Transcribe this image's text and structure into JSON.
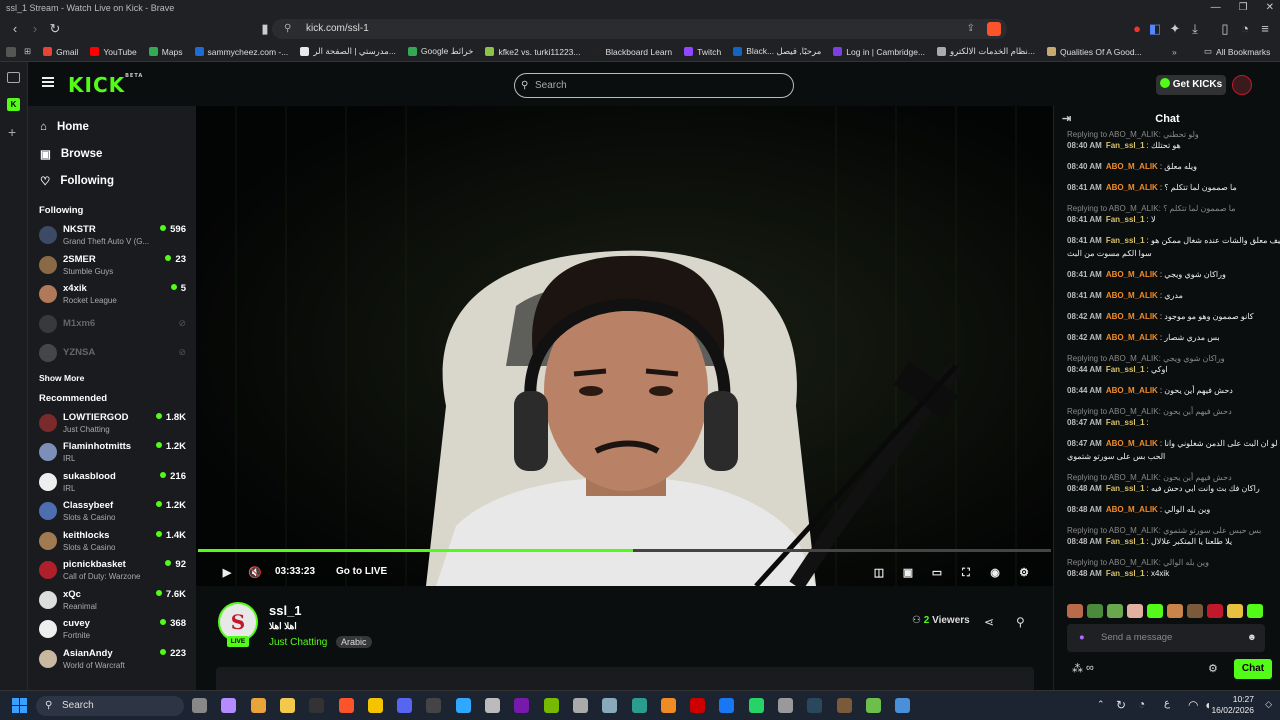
{
  "browser": {
    "window_title": "ssl_1 Stream - Watch Live on Kick - Brave",
    "url": "kick.com/ssl-1",
    "bookmarks": [
      {
        "label": "Gmail",
        "color": "#ea4335"
      },
      {
        "label": "YouTube",
        "color": "#ff0000"
      },
      {
        "label": "Maps",
        "color": "#34a853"
      },
      {
        "label": "sammycheez.com -...",
        "color": "#1e6bd6"
      },
      {
        "label": "مدرستي | الصفحة الر...",
        "color": "#e8e8e8"
      },
      {
        "label": "Google خرائط",
        "color": "#34a853"
      },
      {
        "label": "kfke2 vs. turki11223...",
        "color": "#8bc34a"
      },
      {
        "label": "Blackboard Learn",
        "color": "#222222"
      },
      {
        "label": "Twitch",
        "color": "#9146ff"
      },
      {
        "label": "Black... مرحبًا, فيصل",
        "color": "#1565c0"
      },
      {
        "label": "Log in | Cambridge...",
        "color": "#7b3fe4"
      },
      {
        "label": "نظام الخدمات الالكترو...",
        "color": "#aaaaaa"
      },
      {
        "label": "Qualities Of A Good...",
        "color": "#c8a96e"
      }
    ],
    "all_bookmarks": "All Bookmarks"
  },
  "kick": {
    "logo": "KICK",
    "logo_beta": "BETA",
    "search_placeholder": "Search",
    "get_kicks": "Get KICKs",
    "nav": [
      {
        "label": "Home",
        "icon": "home-icon"
      },
      {
        "label": "Browse",
        "icon": "browse-icon"
      },
      {
        "label": "Following",
        "icon": "heart-icon"
      }
    ],
    "following_title": "Following",
    "following": [
      {
        "name": "NKSTR",
        "category": "Grand Theft Auto V (G...",
        "viewers": "596",
        "color": "#3c4a66",
        "online": true
      },
      {
        "name": "2SMER",
        "category": "Stumble Guys",
        "viewers": "23",
        "color": "#8a6a44",
        "online": true
      },
      {
        "name": "x4xik",
        "category": "Rocket League",
        "viewers": "5",
        "color": "#b07a5a",
        "online": true
      },
      {
        "name": "M1xm6",
        "online": false,
        "color": "#666666"
      },
      {
        "name": "YZNSA",
        "online": false,
        "color": "#888888"
      }
    ],
    "show_more": "Show More",
    "recommended_title": "Recommended",
    "recommended": [
      {
        "name": "LOWTIERGOD",
        "category": "Just Chatting",
        "viewers": "1.8K",
        "color": "#7a2a2a"
      },
      {
        "name": "Flaminhotmitts",
        "category": "IRL",
        "viewers": "1.2K",
        "color": "#7d8fb8"
      },
      {
        "name": "sukasblood",
        "category": "IRL",
        "viewers": "216",
        "color": "#eeeeee"
      },
      {
        "name": "Classybeef",
        "category": "Slots & Casino",
        "viewers": "1.2K",
        "color": "#4d6fb0"
      },
      {
        "name": "keithlocks",
        "category": "Slots & Casino",
        "viewers": "1.4K",
        "color": "#a27a52"
      },
      {
        "name": "picnickbasket",
        "category": "Call of Duty: Warzone",
        "viewers": "92",
        "color": "#b0202a"
      },
      {
        "name": "xQc",
        "category": "Reanimal",
        "viewers": "7.6K",
        "color": "#dddddd"
      },
      {
        "name": "cuvey",
        "category": "Fortnite",
        "viewers": "368",
        "color": "#eeeeee"
      },
      {
        "name": "AsianAndy",
        "category": "World of Warcraft",
        "viewers": "223",
        "color": "#c9b8a0"
      }
    ],
    "player": {
      "time": "03:33:23",
      "go_live": "Go to LIVE",
      "progress": 0.51
    },
    "stream": {
      "channel": "ssl_1",
      "avatar_letter": "S",
      "live": "LIVE",
      "title": "اهلا اهلا",
      "category": "Just Chatting",
      "language": "Arabic",
      "viewers_count": "2",
      "viewers_label": "Viewers"
    },
    "chat": {
      "title": "Chat",
      "input_placeholder": "Send a message",
      "send": "Chat",
      "messages": [
        {
          "reply": "Replying to ABO_M_ALIK: ولو تحطني",
          "time": "08:40 AM",
          "user": "Fan_ssl_1",
          "text": "هو تحتلك",
          "color": "#d9c26a"
        },
        {
          "time": "08:40 AM",
          "user": "ABO_M_ALIK",
          "text": "ويله معلق",
          "color": "#f28c28"
        },
        {
          "time": "08:41 AM",
          "user": "ABO_M_ALIK",
          "text": "ما صممون لما تتكلم ؟",
          "color": "#f28c28"
        },
        {
          "reply": "Replying to ABO_M_ALIK: ما صممون لما تتكلم ؟",
          "time": "08:41 AM",
          "user": "Fan_ssl_1",
          "text": "لا",
          "color": "#d9c26a"
        },
        {
          "time": "08:41 AM",
          "user": "Fan_ssl_1",
          "text": "كيف معلق والشات عنده شغال ممكن هو",
          "text2": "سوا الكم مسوت من البث",
          "color": "#d9c26a"
        },
        {
          "time": "08:41 AM",
          "user": "ABO_M_ALIK",
          "text": "وراكان شوي ويجي",
          "color": "#f28c28"
        },
        {
          "time": "08:41 AM",
          "user": "ABO_M_ALIK",
          "text": "مدري",
          "color": "#f28c28"
        },
        {
          "time": "08:42 AM",
          "user": "ABO_M_ALIK",
          "text": "كانو صممون وهو مو موجود",
          "color": "#f28c28"
        },
        {
          "time": "08:42 AM",
          "user": "ABO_M_ALIK",
          "text": "بس مدري شصار",
          "color": "#f28c28"
        },
        {
          "reply": "Replying to ABO_M_ALIK: وراكان شوي ويجي",
          "time": "08:44 AM",
          "user": "Fan_ssl_1",
          "text": "اوكي",
          "color": "#d9c26a"
        },
        {
          "time": "08:44 AM",
          "user": "ABO_M_ALIK",
          "text": "دحش فيهم أين يحون",
          "color": "#f28c28"
        },
        {
          "reply": "Replying to ABO_M_ALIK: دحش فيهم أين يحون",
          "time": "08:47 AM",
          "user": "Fan_ssl_1",
          "text": "",
          "color": "#d9c26a"
        },
        {
          "time": "08:47 AM",
          "user": "ABO_M_ALIK",
          "text": "لو ان البث على الدمن شغلوني وانا",
          "text2": "الحب بس على سورتو شتموي",
          "color": "#f28c28"
        },
        {
          "reply": "Replying to ABO_M_ALIK: دحش فيهم أين يحون",
          "time": "08:48 AM",
          "user": "Fan_ssl_1",
          "text": "راكان فك بث وانت ابي دحش فيه",
          "color": "#d9c26a"
        },
        {
          "time": "08:48 AM",
          "user": "ABO_M_ALIK",
          "text": "وين بله الوالي",
          "color": "#f28c28"
        },
        {
          "reply": "Replying to ABO_M_ALIK: بس حبس على سورتو شتموي",
          "time": "08:48 AM",
          "user": "Fan_ssl_1",
          "text": "يلا طلعنا يا المتكبر علالال",
          "color": "#d9c26a"
        },
        {
          "reply": "Replying to ABO_M_ALIK: وين بله الوالي",
          "time": "08:48 AM",
          "user": "Fan_ssl_1",
          "text": "x4xik",
          "color": "#d9c26a"
        }
      ]
    }
  },
  "taskbar": {
    "search": "Search",
    "time": "10:27",
    "date": "16/02/2026",
    "lang": "ع"
  }
}
